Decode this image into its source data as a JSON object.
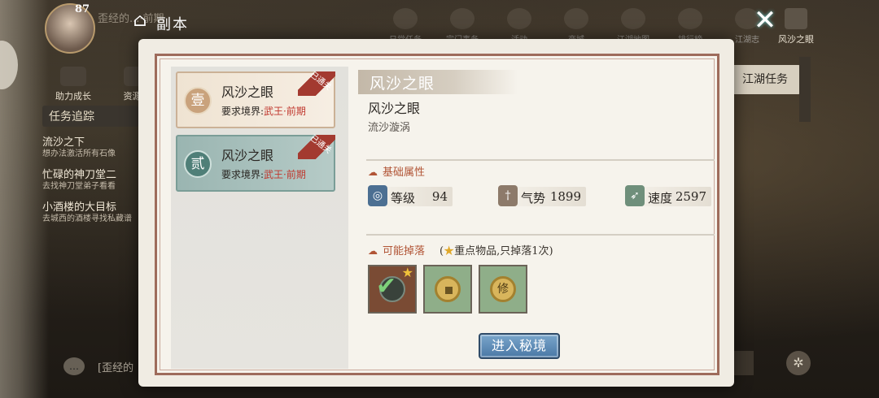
{
  "header": {
    "title": "副本",
    "player_level": "87",
    "player_text": "歪经的...·前期",
    "player_sub": "1..."
  },
  "top_tabs": [
    "日常任务",
    "宗门事务",
    "活动",
    "商城",
    "江湖地图",
    "排行榜",
    "江湖志"
  ],
  "active_tab": "风沙之眼",
  "growth_buttons": [
    "助力成长",
    "资源礼"
  ],
  "quest_panel": {
    "header": "任务追踪",
    "items": [
      {
        "title": "流沙之下",
        "desc": "想办法激活所有石像"
      },
      {
        "title": "忙碌的神刀堂二",
        "desc": "去找神刀堂弟子看看"
      },
      {
        "title": "小酒楼的大目标",
        "desc": "去城西的酒楼寻找私藏谱"
      }
    ]
  },
  "chat": {
    "text": "[歪经的"
  },
  "right_task": "江湖任务",
  "stages": [
    {
      "badge": "壹",
      "name": "风沙之眼",
      "req_prefix": "要求境界:",
      "realm": "武王·前期",
      "ribbon": "已通关"
    },
    {
      "badge": "贰",
      "name": "风沙之眼",
      "req_prefix": "要求境界:",
      "realm": "武王·前期",
      "ribbon": "已通关"
    }
  ],
  "detail": {
    "banner": "风沙之眼",
    "name": "风沙之眼",
    "subtitle": "流沙漩涡",
    "base_section": "基础属性",
    "stats": [
      {
        "label": "等级",
        "value": "94",
        "icon": "swirl-icon"
      },
      {
        "label": "气势",
        "value": "1899",
        "icon": "sword-icon"
      },
      {
        "label": "速度",
        "value": "2597",
        "icon": "boot-icon"
      }
    ],
    "drop_section": "可能掉落",
    "drop_note_open": "(",
    "drop_note_text": "重点物品,只掉落1次)",
    "drops": [
      "check-stone-item",
      "coin-item",
      "cultivation-coin-item"
    ],
    "drop3_text": "修",
    "enter_button": "进入秘境"
  },
  "colors": {
    "accent_red": "#c0372d",
    "button_blue": "#4a78a6",
    "frame": "#9e6b5b"
  }
}
